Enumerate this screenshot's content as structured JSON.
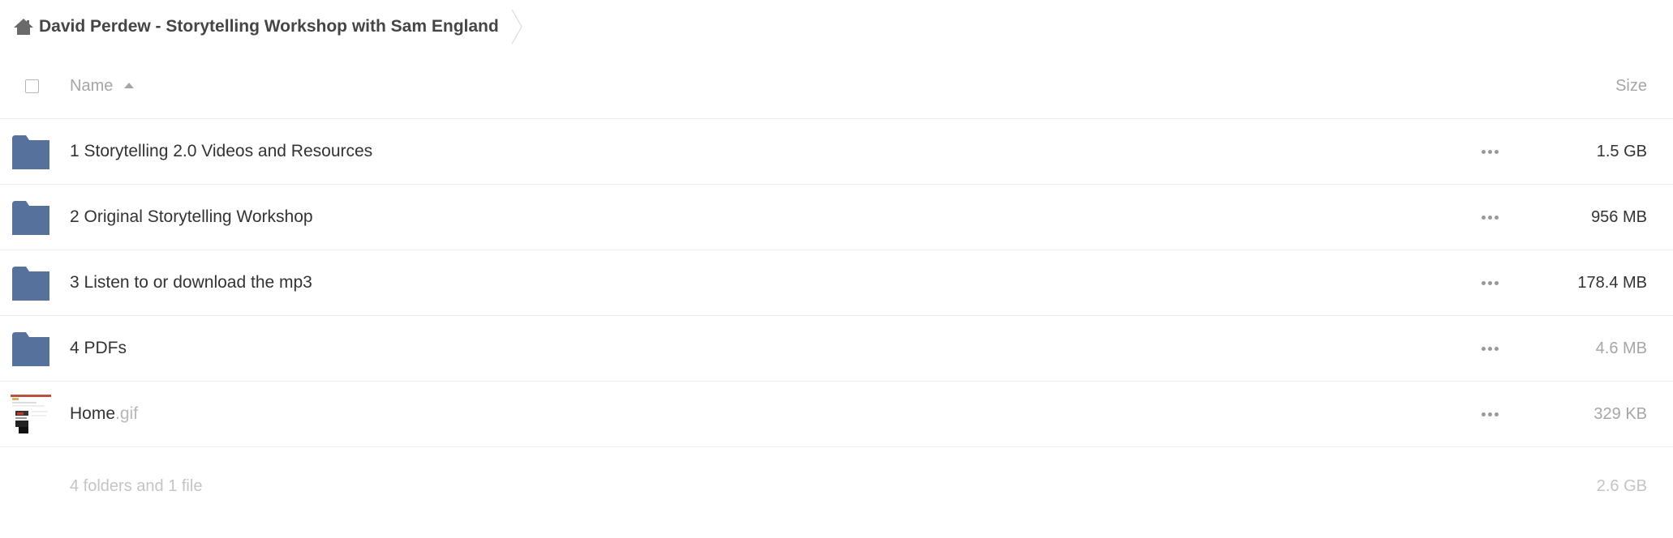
{
  "breadcrumb": {
    "home_icon": "home-icon",
    "title": "David Perdew - Storytelling Workshop with Sam England"
  },
  "table": {
    "headers": {
      "name": "Name",
      "size": "Size"
    },
    "rows": [
      {
        "type": "folder",
        "name": "1 Storytelling 2.0 Videos and Resources",
        "ext": "",
        "size": "1.5 GB"
      },
      {
        "type": "folder",
        "name": "2 Original Storytelling Workshop",
        "ext": "",
        "size": "956 MB"
      },
      {
        "type": "folder",
        "name": "3 Listen to or download the mp3",
        "ext": "",
        "size": "178.4 MB"
      },
      {
        "type": "folder",
        "name": "4 PDFs",
        "ext": "",
        "size": "4.6 MB"
      },
      {
        "type": "file",
        "name": "Home",
        "ext": ".gif",
        "size": "329 KB"
      }
    ],
    "summary": {
      "text": "4 folders and 1 file",
      "size": "2.6 GB"
    }
  },
  "colors": {
    "folder": "#56719b",
    "muted": "#a6a6a6"
  }
}
